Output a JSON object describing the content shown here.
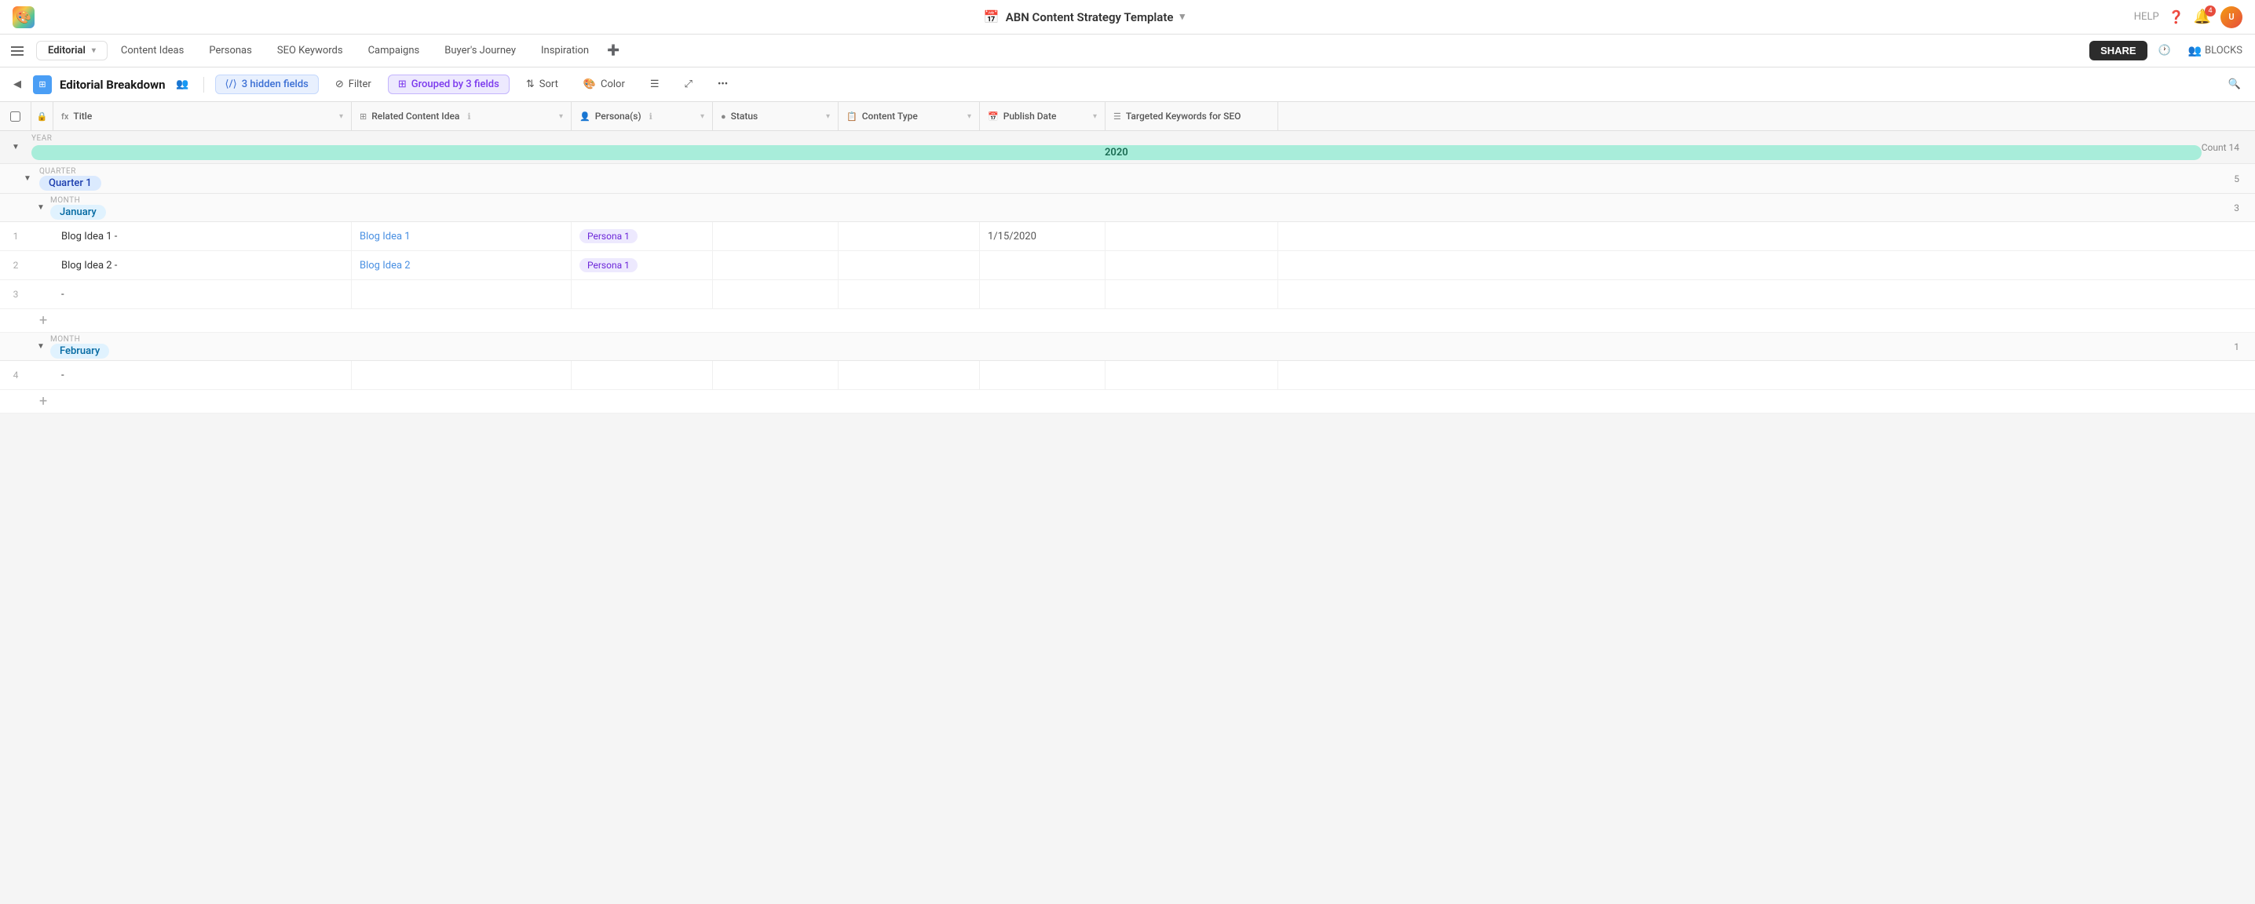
{
  "app": {
    "logo": "🎨",
    "title": "ABN Content Strategy Template",
    "title_icon": "📅",
    "dropdown_arrow": "▾"
  },
  "topbar": {
    "help": "HELP",
    "notification_count": "4",
    "share_label": "SHARE",
    "blocks_label": "BLOCKS"
  },
  "tabs": [
    {
      "id": "editorial",
      "label": "Editorial",
      "active": true,
      "has_dropdown": true
    },
    {
      "id": "content-ideas",
      "label": "Content Ideas",
      "active": false
    },
    {
      "id": "personas",
      "label": "Personas",
      "active": false
    },
    {
      "id": "seo-keywords",
      "label": "SEO Keywords",
      "active": false
    },
    {
      "id": "campaigns",
      "label": "Campaigns",
      "active": false
    },
    {
      "id": "buyers-journey",
      "label": "Buyer's Journey",
      "active": false
    },
    {
      "id": "inspiration",
      "label": "Inspiration",
      "active": false
    }
  ],
  "toolbar": {
    "view_label": "Editorial Breakdown",
    "hidden_fields_label": "3 hidden fields",
    "filter_label": "Filter",
    "grouped_label": "Grouped by 3 fields",
    "sort_label": "Sort",
    "color_label": "Color"
  },
  "columns": [
    {
      "id": "title",
      "label": "Title",
      "icon": "fx"
    },
    {
      "id": "related",
      "label": "Related Content Idea",
      "icon": "⊞"
    },
    {
      "id": "personas",
      "label": "Persona(s)",
      "icon": "👤"
    },
    {
      "id": "status",
      "label": "Status",
      "icon": "●"
    },
    {
      "id": "type",
      "label": "Content Type",
      "icon": "📅"
    },
    {
      "id": "date",
      "label": "Publish Date",
      "icon": "📅"
    },
    {
      "id": "keywords",
      "label": "Targeted Keywords for SEO",
      "icon": "☰"
    }
  ],
  "data": {
    "year": "2020",
    "year_count": "Count 14",
    "year_badge_color": "#a8edda",
    "year_text_color": "#1a6b52",
    "quarters": [
      {
        "label": "Quarter 1",
        "count": "5",
        "months": [
          {
            "label": "January",
            "count": "3",
            "rows": [
              {
                "num": "1",
                "title": "Blog Idea 1 -",
                "related": "Blog Idea 1",
                "persona": "Persona 1",
                "status": "",
                "type": "",
                "date": "1/15/2020",
                "keywords": ""
              },
              {
                "num": "2",
                "title": "Blog Idea 2 -",
                "related": "Blog Idea 2",
                "persona": "Persona 1",
                "status": "",
                "type": "",
                "date": "",
                "keywords": ""
              },
              {
                "num": "3",
                "title": "-",
                "related": "",
                "persona": "",
                "status": "",
                "type": "",
                "date": "",
                "keywords": ""
              }
            ]
          },
          {
            "label": "February",
            "count": "1",
            "rows": [
              {
                "num": "4",
                "title": "-",
                "related": "",
                "persona": "",
                "status": "",
                "type": "",
                "date": "",
                "keywords": ""
              }
            ]
          }
        ]
      }
    ]
  }
}
